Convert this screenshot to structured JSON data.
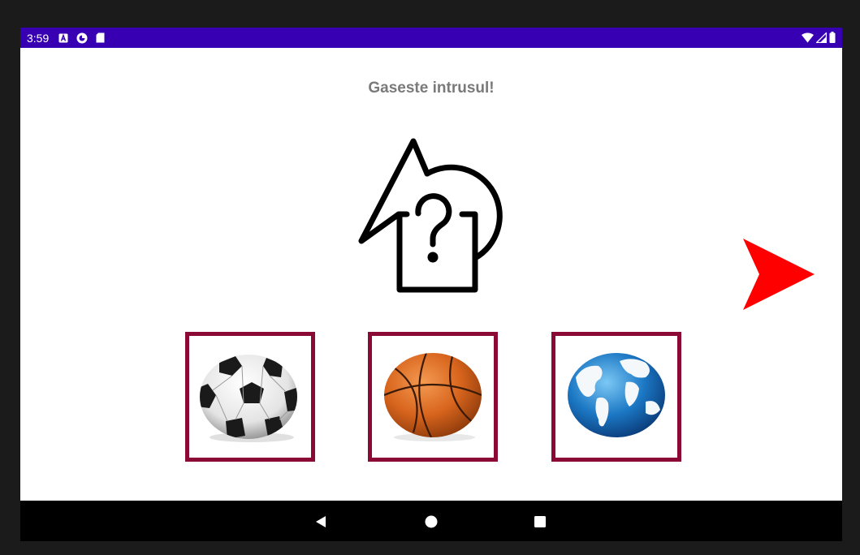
{
  "status_bar": {
    "time": "3:59",
    "left_icons": [
      "a-notification-icon",
      "sync-icon",
      "sd-card-icon"
    ],
    "right_icons": [
      "wifi-icon",
      "signal-icon",
      "battery-icon"
    ],
    "background_color": "#3700b3"
  },
  "main": {
    "title": "Gaseste intrusul!",
    "center_icon": "shapes-question-icon",
    "next_icon": "next-arrow-icon",
    "next_color": "#ff0000",
    "options": [
      {
        "icon": "soccer-ball-icon"
      },
      {
        "icon": "basketball-icon"
      },
      {
        "icon": "globe-icon"
      }
    ],
    "option_border_color": "#8b0a35"
  },
  "nav_bar": {
    "buttons": [
      "back-icon",
      "home-icon",
      "recents-icon"
    ]
  }
}
